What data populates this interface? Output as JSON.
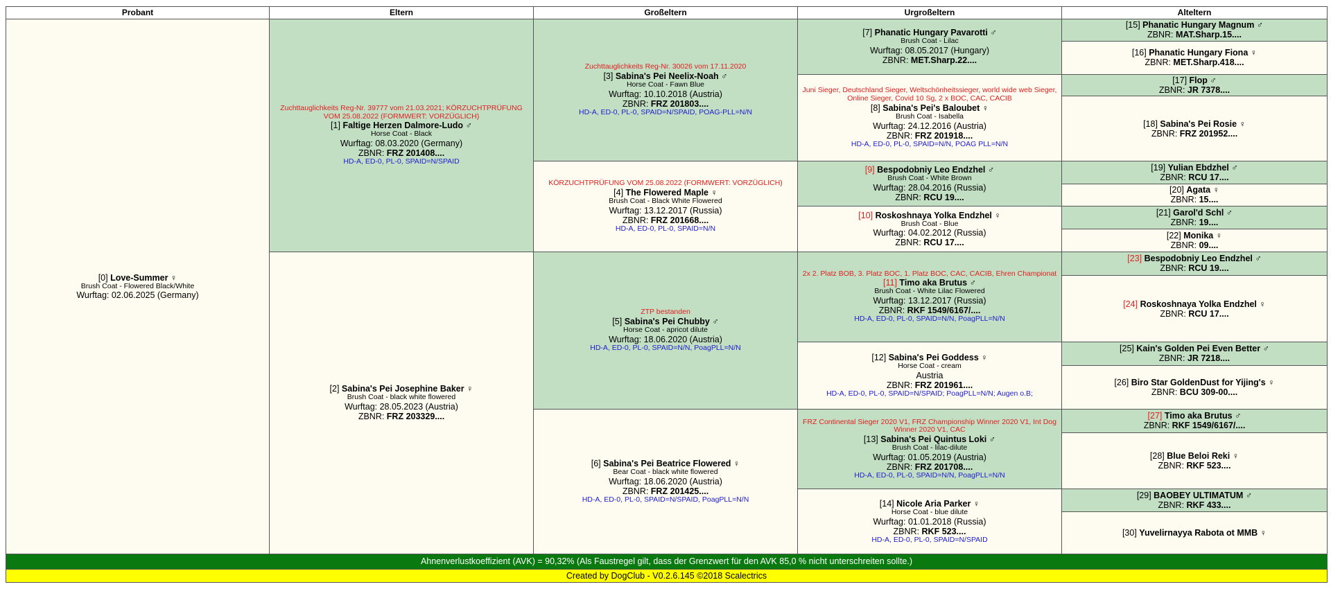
{
  "headers": [
    "Probant",
    "Eltern",
    "Großeltern",
    "Urgroßeltern",
    "Alteltern"
  ],
  "labels": {
    "wurftag": "Wurftag:",
    "zbnr": "ZBNR:"
  },
  "dogs": {
    "d0": {
      "num": "[0]",
      "name": "Love-Summer",
      "sex": "♀",
      "coat": "Brush Coat - Flowered Black/White",
      "wurftag": "02.06.2025 (Germany)"
    },
    "d1": {
      "honors": "Zuchttauglichkeits Reg-Nr. 39777 vom 21.03.2021; KÖRZUCHTPRÜFUNG VOM 25.08.2022 (FORMWERT: VORZÜGLICH)",
      "num": "[1]",
      "name": "Faltige Herzen Dalmore-Ludo",
      "sex": "♂",
      "coat": "Horse Coat - Black",
      "wurftag": "08.03.2020 (Germany)",
      "zbnr": "FRZ 201408....",
      "health": "HD-A, ED-0, PL-0, SPAID=N/SPAID"
    },
    "d2": {
      "num": "[2]",
      "name": "Sabina's Pei Josephine Baker",
      "sex": "♀",
      "coat": "Brush Coat - black white flowered",
      "wurftag": "28.05.2023 (Austria)",
      "zbnr": "FRZ 203329...."
    },
    "d3": {
      "honors": "Zuchttauglichkeits Reg-Nr. 30026 vom 17.11.2020",
      "num": "[3]",
      "name": "Sabina's Pei Neelix-Noah",
      "sex": "♂",
      "coat": "Horse Coat - Fawn Blue",
      "wurftag": "10.10.2018 (Austria)",
      "zbnr": "FRZ 201803....",
      "health": "HD-A, ED-0, PL-0, SPAID=N/SPAID, POAG-PLL=N/N"
    },
    "d4": {
      "honors": "KÖRZUCHTPRÜFUNG VOM 25.08.2022 (FORMWERT: VORZÜGLICH)",
      "num": "[4]",
      "name": "The Flowered Maple",
      "sex": "♀",
      "coat": "Brush Coat - Black White Flowered",
      "wurftag": "13.12.2017 (Russia)",
      "zbnr": "FRZ 201668....",
      "health": "HD-A, ED-0, PL-0, SPAID=N/N"
    },
    "d5": {
      "honors": "ZTP bestanden",
      "num": "[5]",
      "name": "Sabina's Pei Chubby",
      "sex": "♂",
      "coat": "Horse Coat - apricot dilute",
      "wurftag": "18.06.2020 (Austria)",
      "health": "HD-A, ED-0, PL-0, SPAID=N/N, PoagPLL=N/N"
    },
    "d6": {
      "num": "[6]",
      "name": "Sabina's Pei Beatrice Flowered",
      "sex": "♀",
      "coat": "Bear Coat - black white flowered",
      "wurftag": "18.06.2020 (Austria)",
      "zbnr": "FRZ 201425....",
      "health": "HD-A, ED-0, PL-0, SPAID=N/SPAID, PoagPLL=N/N"
    },
    "d7": {
      "num": "[7]",
      "name": "Phanatic Hungary Pavarotti",
      "sex": "♂",
      "coat": "Brush Coat - Lilac",
      "wurftag": "08.05.2017 (Hungary)",
      "zbnr": "MET.Sharp.22...."
    },
    "d8": {
      "honors": "Juni Sieger, Deutschland Sieger, Weltschönheitssieger, world wide web Sieger, Online Sieger, Covid 10 Sg, 2 x BOC, CAC, CACIB",
      "num": "[8]",
      "name": "Sabina's Pei's Baloubet",
      "sex": "♀",
      "coat": "Brush Coat - Isabella",
      "wurftag": "24.12.2016 (Austria)",
      "zbnr": "FRZ 201918....",
      "health": "HD-A, ED-0, PL-0, SPAID=N/N, POAG PLL=N/N"
    },
    "d9": {
      "num": "[9]",
      "name": "Bespodobniy Leo Endzhel",
      "sex": "♂",
      "coat": "Brush Coat - White Brown",
      "wurftag": "28.04.2016 (Russia)",
      "zbnr": "RCU 19...."
    },
    "d10": {
      "num": "[10]",
      "name": "Roskoshnaya Yolka Endzhel",
      "sex": "♀",
      "coat": "Brush Coat - Blue",
      "wurftag": "04.02.2012 (Russia)",
      "zbnr": "RCU 17...."
    },
    "d11": {
      "honors": "2x 2. Platz BOB, 3. Platz BOC, 1. Platz BOC, CAC, CACIB, Ehren Championat",
      "num": "[11]",
      "name": "Timo aka Brutus",
      "sex": "♂",
      "coat": "Brush Coat - White Lilac Flowered",
      "wurftag": "13.12.2017 (Russia)",
      "zbnr": "RKF 1549/6167/....",
      "health": "HD-A, ED-0, PL-0, SPAID=N/N, PoagPLL=N/N"
    },
    "d12": {
      "num": "[12]",
      "name": "Sabina's Pei Goddess",
      "sex": "♀",
      "coat": "Horse Coat - cream",
      "country": "Austria",
      "zbnr": "FRZ 201961....",
      "health": "HD-A, ED-0, PL-0, SPAID=N/SPAID; PoagPLL=N/N; Augen o.B;"
    },
    "d13": {
      "honors": "FRZ Continental Sieger 2020 V1, FRZ Championship Winner 2020 V1, Int Dog Winner 2020 V1, CAC",
      "num": "[13]",
      "name": "Sabina's Pei Quintus Loki",
      "sex": "♂",
      "coat": "Brush Coat - lilac-dilute",
      "wurftag": "01.05.2019 (Austria)",
      "zbnr": "FRZ 201708....",
      "health": "HD-A, ED-0, PL-0, SPAID=N/N, PoagPLL=N/N"
    },
    "d14": {
      "num": "[14]",
      "name": "Nicole Aria Parker",
      "sex": "♀",
      "coat": "Horse Coat - blue dilute",
      "wurftag": "01.01.2018 (Russia)",
      "zbnr": "RKF 523....",
      "health": "HD-A, ED-0, PL-0, SPAID=N/SPAID"
    },
    "d15": {
      "num": "[15]",
      "name": "Phanatic Hungary Magnum",
      "sex": "♂",
      "zbnr": "MAT.Sharp.15...."
    },
    "d16": {
      "num": "[16]",
      "name": "Phanatic Hungary Fiona",
      "sex": "♀",
      "zbnr": "MET.Sharp.418...."
    },
    "d17": {
      "num": "[17]",
      "name": "Flop",
      "sex": "♂",
      "zbnr": "JR 7378...."
    },
    "d18": {
      "num": "[18]",
      "name": "Sabina's Pei Rosie",
      "sex": "♀",
      "zbnr": "FRZ 201952...."
    },
    "d19": {
      "num": "[19]",
      "name": "Yulian Ebdzhel",
      "sex": "♂",
      "zbnr": "RCU 17...."
    },
    "d20": {
      "num": "[20]",
      "name": "Agata",
      "sex": "♀",
      "zbnr": "15...."
    },
    "d21": {
      "num": "[21]",
      "name": "Garol'd Schl",
      "sex": "♂",
      "zbnr": "19...."
    },
    "d22": {
      "num": "[22]",
      "name": "Monika",
      "sex": "♀",
      "zbnr": "09...."
    },
    "d23": {
      "num": "[23]",
      "name": "Bespodobniy Leo Endzhel",
      "sex": "♂",
      "zbnr": "RCU 19...."
    },
    "d24": {
      "num": "[24]",
      "name": "Roskoshnaya Yolka Endzhel",
      "sex": "♀",
      "zbnr": "RCU 17...."
    },
    "d25": {
      "num": "[25]",
      "name": "Kain's Golden Pei Even Better",
      "sex": "♂",
      "zbnr": "JR 7218...."
    },
    "d26": {
      "num": "[26]",
      "name": "Biro Star GoldenDust for Yijing's",
      "sex": "♀",
      "zbnr": "BCU 309-00...."
    },
    "d27": {
      "num": "[27]",
      "name": "Timo aka Brutus",
      "sex": "♂",
      "zbnr": "RKF 1549/6167/...."
    },
    "d28": {
      "num": "[28]",
      "name": "Blue Beloi Reki",
      "sex": "♀",
      "zbnr": "RKF 523...."
    },
    "d29": {
      "num": "[29]",
      "name": "BAOBEY ULTIMATUM",
      "sex": "♂",
      "zbnr": "RKF 433...."
    },
    "d30": {
      "num": "[30]",
      "name": "Yuvelirnayya Rabota ot MMB",
      "sex": "♀"
    }
  },
  "footer": {
    "avk": "Ahnenverlustkoeffizient (AVK) = 90,32% (Als Faustregel gilt, dass der Grenzwert für den AVK  85,0 % nicht unterschreiten sollte.)",
    "credit": "Created by DogClub - V0.2.6.145 ©2018 Scalectrics"
  },
  "colors": {
    "male_bg": "#c2dfc4",
    "female_bg": "#fefbf0",
    "honors": "#e02020",
    "health": "#1c1ccf",
    "footer_green": "#0a7a10",
    "footer_yellow": "#ffff00"
  }
}
